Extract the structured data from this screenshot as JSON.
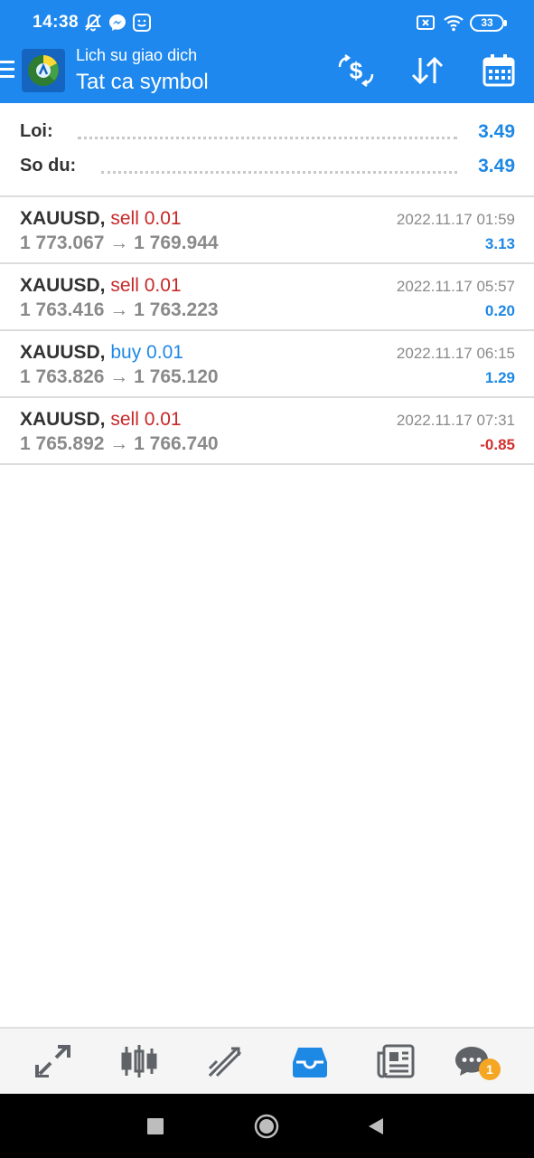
{
  "status_bar": {
    "time": "14:38",
    "battery": "33",
    "icons": [
      "muted-bell-icon",
      "messenger-icon",
      "smile-app-icon",
      "sim-x-icon",
      "wifi-icon",
      "battery-icon"
    ]
  },
  "header": {
    "subtitle": "Lich su giao dich",
    "title": "Tat ca symbol",
    "actions": [
      "currency-exchange-icon",
      "sort-icon",
      "calendar-icon"
    ]
  },
  "summary": {
    "profit_label": "Loi:",
    "profit_value": "3.49",
    "balance_label": "So du:",
    "balance_value": "3.49"
  },
  "trades": [
    {
      "symbol": "XAUUSD,",
      "side": "sell 0.01",
      "direction": "sell",
      "open": "1 773.067",
      "close": "1 769.944",
      "time": "2022.11.17 01:59",
      "profit": "3.13",
      "profit_sign": "positive"
    },
    {
      "symbol": "XAUUSD,",
      "side": "sell 0.01",
      "direction": "sell",
      "open": "1 763.416",
      "close": "1 763.223",
      "time": "2022.11.17 05:57",
      "profit": "0.20",
      "profit_sign": "positive"
    },
    {
      "symbol": "XAUUSD,",
      "side": "buy 0.01",
      "direction": "buy",
      "open": "1 763.826",
      "close": "1 765.120",
      "time": "2022.11.17 06:15",
      "profit": "1.29",
      "profit_sign": "positive"
    },
    {
      "symbol": "XAUUSD,",
      "side": "sell 0.01",
      "direction": "sell",
      "open": "1 765.892",
      "close": "1 766.740",
      "time": "2022.11.17 07:31",
      "profit": "-0.85",
      "profit_sign": "negative"
    }
  ],
  "arrow": "→",
  "tabbar": {
    "tabs": [
      "quotes-icon",
      "chart-icon",
      "trade-icon",
      "history-icon",
      "news-icon",
      "chat-icon"
    ],
    "active": "history-icon",
    "chat_badge": "1"
  },
  "colors": {
    "primary": "#1e88ee",
    "sell": "#c62828",
    "buy": "#1e88e5",
    "positive": "#1e88e5",
    "negative": "#d32f2f"
  }
}
